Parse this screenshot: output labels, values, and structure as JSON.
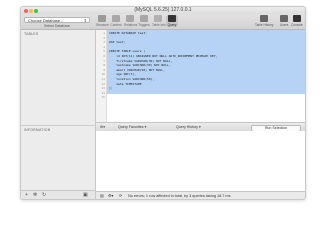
{
  "window": {
    "title": "(MySQL 5.6.25) 127.0.0.1"
  },
  "toolbar": {
    "database_select": "Choose Database...",
    "database_caption": "Select Database",
    "tools": [
      {
        "label": "Structure",
        "icon": "structure-icon"
      },
      {
        "label": "Content",
        "icon": "content-icon"
      },
      {
        "label": "Relations",
        "icon": "relations-icon"
      },
      {
        "label": "Triggers",
        "icon": "triggers-icon"
      },
      {
        "label": "Table Info",
        "icon": "table-info-icon"
      },
      {
        "label": "Query",
        "icon": "query-icon",
        "active": true
      }
    ],
    "right_tools": [
      {
        "label": "Table History",
        "icon": "table-history-icon"
      },
      {
        "label": "Users",
        "icon": "users-icon"
      },
      {
        "label": "Console",
        "icon": "console-icon"
      }
    ]
  },
  "sidebar": {
    "tables_header": "TABLES",
    "information_header": "INFORMATION",
    "bottom_icons": [
      "+",
      "✻",
      "↻",
      "▣"
    ]
  },
  "editor": {
    "line_numbers": [
      "1",
      "2",
      "3",
      "4",
      "5",
      "6",
      "7",
      "8",
      "9",
      "10",
      "11",
      "12",
      "13",
      "14",
      "15"
    ],
    "lines": [
      "CREATE DATABASE test;",
      "",
      "USE test;",
      "",
      "CREATE TABLE users (",
      "    id INT(11) UNSIGNED NOT NULL AUTO_INCREMENT PRIMARY KEY,",
      "    firstname VARCHAR(30) NOT NULL,",
      "    lastname VARCHAR(30) NOT NULL,",
      "    email VARCHAR(50) NOT NULL,",
      "    age INT(3),",
      "    location VARCHAR(50),",
      "    date TIMESTAMP",
      ");",
      "",
      ""
    ]
  },
  "command_bar": {
    "gear": "⚙▾",
    "query_favorites": "Query Favorites",
    "query_history": "Query History",
    "run_selection": "Run Selection"
  },
  "statusbar": {
    "icons": [
      "▤",
      "⚙▾",
      "⟳"
    ],
    "message": "No errors; 1 row affected in total, by 3 queries taking 18.7 ms"
  }
}
